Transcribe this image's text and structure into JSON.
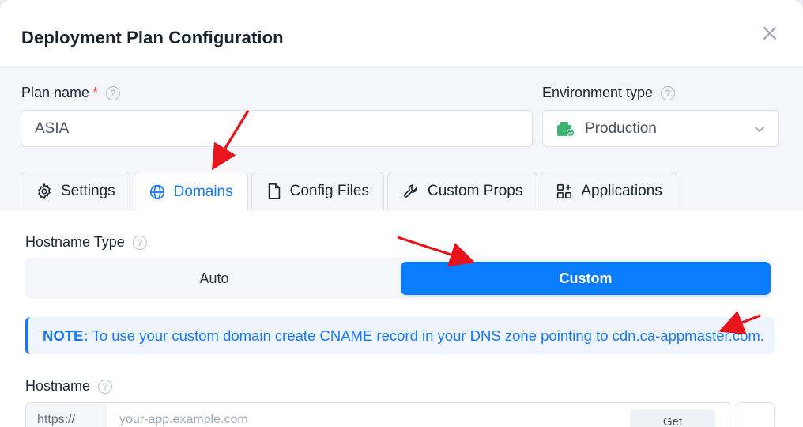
{
  "dialog": {
    "title": "Deployment Plan Configuration"
  },
  "plan": {
    "label": "Plan name",
    "required_mark": "*",
    "value": "ASIA"
  },
  "environment": {
    "label": "Environment type",
    "value": "Production"
  },
  "tabs": [
    {
      "label": "Settings",
      "icon": "gear-icon"
    },
    {
      "label": "Domains",
      "icon": "globe-icon",
      "active": true
    },
    {
      "label": "Config Files",
      "icon": "file-icon"
    },
    {
      "label": "Custom Props",
      "icon": "wrench-icon"
    },
    {
      "label": "Applications",
      "icon": "apps-icon"
    }
  ],
  "hostname_type": {
    "label": "Hostname Type",
    "options": [
      "Auto",
      "Custom"
    ],
    "selected": "Custom"
  },
  "note": {
    "prefix": "NOTE:",
    "text": "To use your custom domain create CNAME record in your DNS zone pointing to cdn.ca-appmaster.com."
  },
  "hostname": {
    "label": "Hostname",
    "prefix": "https://",
    "placeholder": "your-app.example.com",
    "button": "Get"
  },
  "colors": {
    "accent": "#0a7cff",
    "note_bg": "#eef5fd",
    "annotation": "#e8141c"
  }
}
